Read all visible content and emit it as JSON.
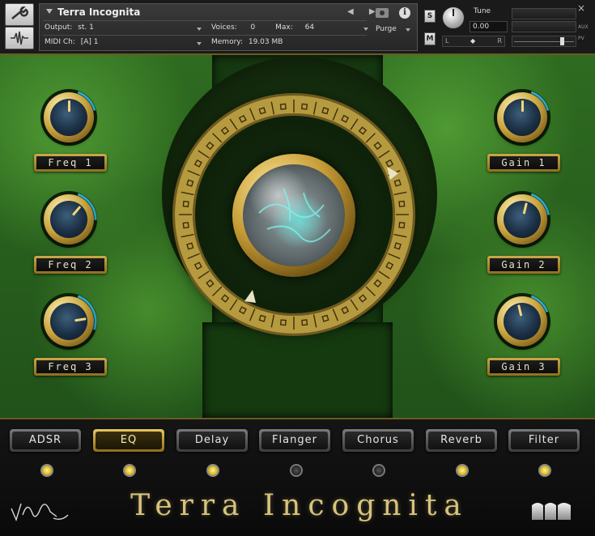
{
  "header": {
    "instrument_name": "Terra Incognita",
    "output_label": "Output:",
    "output_value": "st. 1",
    "voices_label": "Voices:",
    "voices_value": "0",
    "max_label": "Max:",
    "max_value": "64",
    "midi_label": "MIDI Ch:",
    "midi_value": "[A]  1",
    "memory_label": "Memory:",
    "memory_value": "19.03 MB",
    "purge_label": "Purge",
    "solo_label": "S",
    "mute_label": "M",
    "tune_label": "Tune",
    "tune_value": "0.00",
    "pan_left": "L",
    "pan_right": "R",
    "aux_label": "AUX",
    "pv_label": "PV",
    "close_glyph": "×"
  },
  "knobs": {
    "left": [
      {
        "label": "Freq 1",
        "level": 0.5
      },
      {
        "label": "Freq 2",
        "level": 0.65
      },
      {
        "label": "Freq 3",
        "level": 0.8
      }
    ],
    "right": [
      {
        "label": "Gain 1",
        "level": 0.5
      },
      {
        "label": "Gain 2",
        "level": 0.55
      },
      {
        "label": "Gain 3",
        "level": 0.45
      }
    ]
  },
  "tabs": [
    {
      "label": "ADSR",
      "active": false,
      "led_on": true
    },
    {
      "label": "EQ",
      "active": true,
      "led_on": true
    },
    {
      "label": "Delay",
      "active": false,
      "led_on": true
    },
    {
      "label": "Flanger",
      "active": false,
      "led_on": false
    },
    {
      "label": "Chorus",
      "active": false,
      "led_on": false
    },
    {
      "label": "Reverb",
      "active": false,
      "led_on": true
    },
    {
      "label": "Filter",
      "active": false,
      "led_on": true
    }
  ],
  "brand_title": "Terra Incognita",
  "colors": {
    "gold": "#b69a3f",
    "accent_cyan": "#2fb8d8",
    "forest_green": "#2e6b20"
  },
  "icons": {
    "wrench": "wrench-icon",
    "waveform": "waveform-icon",
    "camera": "camera-icon",
    "info": "info-icon"
  }
}
